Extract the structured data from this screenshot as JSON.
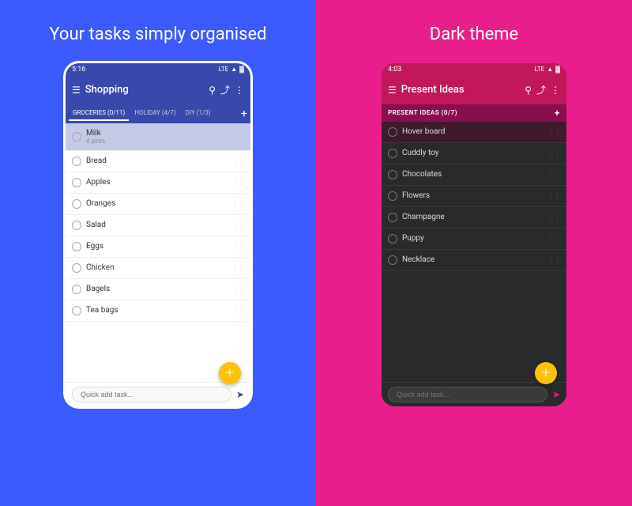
{
  "left_panel": {
    "title": "Your tasks simply organised",
    "bg_color": "#3D5AFE",
    "phone": {
      "status_time": "5:16",
      "status_signal": "LTE",
      "app_bar_title": "Shopping",
      "tabs": [
        {
          "label": "GROCERIES (0/11)",
          "active": true
        },
        {
          "label": "HOLIDAY (4/7)",
          "active": false
        },
        {
          "label": "DIY (1/3)",
          "active": false
        }
      ],
      "list_header": "GROCERIES (0/11)",
      "tasks": [
        {
          "name": "Milk",
          "sub": "4 pints",
          "highlighted": true
        },
        {
          "name": "Bread",
          "sub": ""
        },
        {
          "name": "Apples",
          "sub": ""
        },
        {
          "name": "Oranges",
          "sub": ""
        },
        {
          "name": "Salad",
          "sub": ""
        },
        {
          "name": "Eggs",
          "sub": ""
        },
        {
          "name": "Chicken",
          "sub": ""
        },
        {
          "name": "Bagels",
          "sub": ""
        },
        {
          "name": "Tea bags",
          "sub": ""
        }
      ],
      "quick_add_placeholder": "Quick add task..."
    }
  },
  "right_panel": {
    "title": "Dark theme",
    "bg_color": "#E91E8C",
    "phone": {
      "status_time": "4:03",
      "status_signal": "LTE",
      "app_bar_title": "Present Ideas",
      "list_header": "PRESENT IDEAS (0/7)",
      "tasks": [
        {
          "name": "Hover board",
          "highlighted": true
        },
        {
          "name": "Cuddly toy"
        },
        {
          "name": "Chocolates"
        },
        {
          "name": "Flowers"
        },
        {
          "name": "Champagne"
        },
        {
          "name": "Puppy"
        },
        {
          "name": "Necklace"
        }
      ],
      "quick_add_placeholder": "Quick add task..."
    }
  },
  "icons": {
    "menu": "☰",
    "search": "🔍",
    "share": "⬆",
    "more": "⋮",
    "add": "+",
    "send": "➤",
    "drag": "⋮⋮"
  }
}
